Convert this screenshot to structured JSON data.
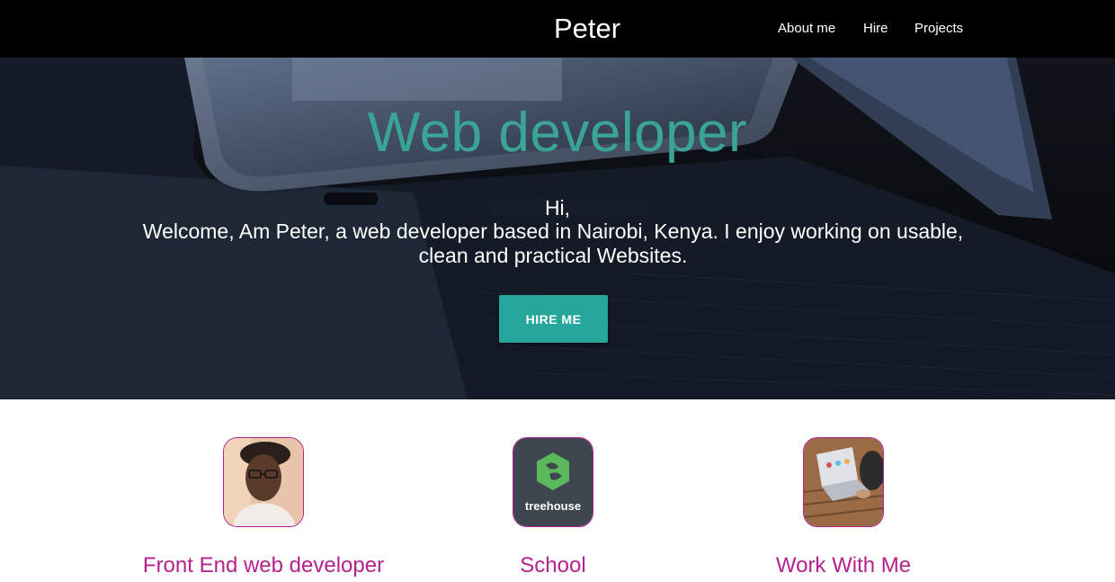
{
  "navbar": {
    "brand": "Peter",
    "links": [
      "About me",
      "Hire",
      "Projects"
    ]
  },
  "hero": {
    "title": "Web developer",
    "greeting": "Hi,",
    "intro": "Welcome, Am Peter, a web developer based in Nairobi, Kenya. I enjoy working on usable, clean and practical Websites.",
    "button_label": "HIRE ME"
  },
  "cards": [
    {
      "title": "Front End web developer",
      "image": "profile-photo"
    },
    {
      "title": "School",
      "image": "treehouse-logo",
      "logo_text": "treehouse"
    },
    {
      "title": "Work With Me",
      "image": "laptop-work-photo"
    }
  ],
  "colors": {
    "navbar_bg": "#000000",
    "accent_teal": "#26a69a",
    "title_teal": "#3aa597",
    "card_title": "#b7218c"
  }
}
